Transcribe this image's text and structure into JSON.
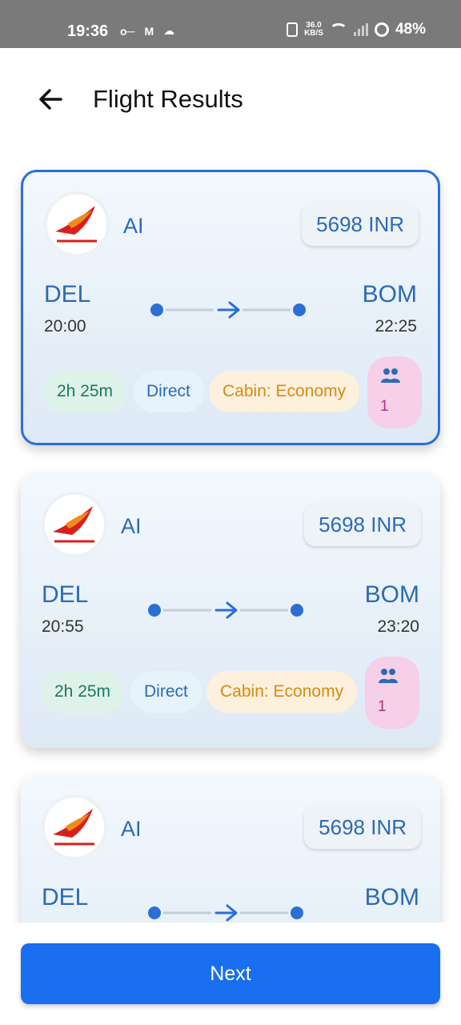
{
  "status_bar": {
    "time": "19:36",
    "left_icons": [
      "key-icon",
      "gmail-icon",
      "cloud-icon"
    ],
    "speed_value": "36.0",
    "speed_unit": "KB/S",
    "battery": "48%"
  },
  "header": {
    "title": "Flight Results",
    "back_icon": "arrow-left-icon"
  },
  "flights": [
    {
      "airline": "AI",
      "price": "5698 INR",
      "from_code": "DEL",
      "from_time": "20:00",
      "to_code": "BOM",
      "to_time": "22:25",
      "duration": "2h 25m",
      "stops": "Direct",
      "cabin": "Cabin: Economy",
      "passengers": "1",
      "selected": true
    },
    {
      "airline": "AI",
      "price": "5698 INR",
      "from_code": "DEL",
      "from_time": "20:55",
      "to_code": "BOM",
      "to_time": "23:20",
      "duration": "2h 25m",
      "stops": "Direct",
      "cabin": "Cabin: Economy",
      "passengers": "1",
      "selected": false
    },
    {
      "airline": "AI",
      "price": "5698 INR",
      "from_code": "DEL",
      "from_time": "",
      "to_code": "BOM",
      "to_time": "",
      "duration": "",
      "stops": "",
      "cabin": "",
      "passengers": "",
      "selected": false
    }
  ],
  "footer": {
    "next_label": "Next"
  },
  "colors": {
    "accent": "#1a6ef0",
    "selected_border": "#2b6fd6",
    "text_blue": "#2b6bb5"
  }
}
